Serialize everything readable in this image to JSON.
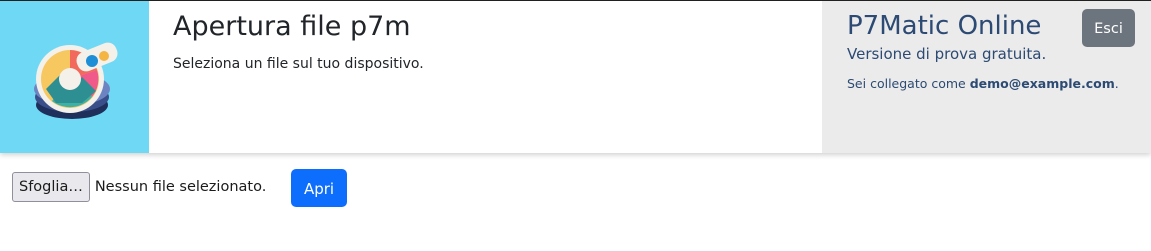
{
  "header": {
    "title": "Apertura file p7m",
    "subtitle": "Seleziona un file sul tuo dispositivo."
  },
  "side": {
    "app_name": "P7Matic Online",
    "version": "Versione di prova gratuita.",
    "login_prefix": "Sei collegato come",
    "login_user": "demo@example.com",
    "login_suffix": ".",
    "logout_label": "Esci"
  },
  "form": {
    "browse_label": "Sfoglia…",
    "file_status": "Nessun file selezionato.",
    "open_label": "Apri"
  },
  "colors": {
    "logo_bg": "#6fd9f5",
    "side_bg": "#ebebeb",
    "accent_text": "#2c4a73",
    "primary": "#0d6efd",
    "secondary": "#6c757d"
  },
  "icons": {
    "logo": "p7matic-logo-icon"
  }
}
